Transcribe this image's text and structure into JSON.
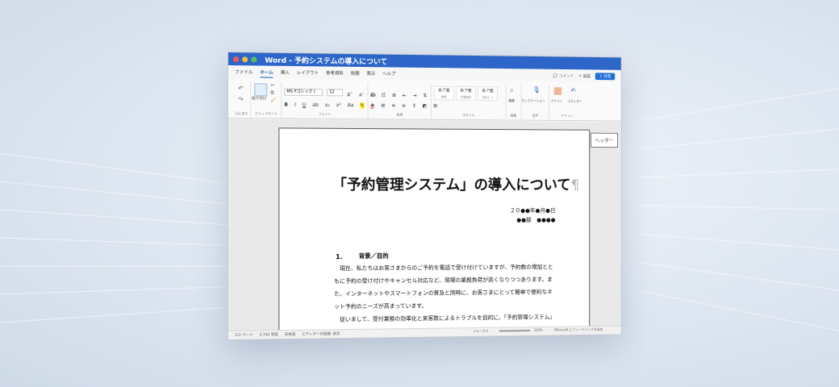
{
  "app": {
    "title": "Word - 予約システムの導入について"
  },
  "tabs": [
    "ファイル",
    "ホーム",
    "挿入",
    "レイアウト",
    "参考資料",
    "校閲",
    "表示",
    "ヘルプ"
  ],
  "title_right": {
    "comment": "コメント",
    "edit": "編集",
    "share": "共有"
  },
  "ribbon": {
    "undo_label": "元に戻す",
    "paste_label": "貼り付け",
    "clipboard_label": "クリップボード",
    "font_name": "MS Pゴシック (",
    "font_size": "12",
    "font_group_label": "フォント",
    "paragraph_group_label": "段落",
    "styles": [
      {
        "preview": "あア亜",
        "name": "標準"
      },
      {
        "preview": "あア亜",
        "name": "行間詰め"
      },
      {
        "preview": "あア亜",
        "name": "見出し 1"
      }
    ],
    "style_group_label": "スタイル",
    "edit_label": "編集",
    "dictate_label": "ディクテーション",
    "addin_label": "アドイン",
    "editor_label": "エディター",
    "voice_group_label": "音声",
    "addin_group_label": "アドイン"
  },
  "document": {
    "header_tag": "ヘッダー",
    "title": "「予約管理システム」の導入について",
    "pilcrow": "¶",
    "date": "２０●●年●月●日",
    "dept": "●●部　●●●●",
    "section_number": "1.",
    "section_title": "背景／目的",
    "body": [
      "　現在、私たちはお客さまからのご予約を電話で受け付けていますが、予約数の増加とと",
      "もに予約の受け付けやキャンセル対応など、現場の業務負荷が高くなりつつあります。ま",
      "た、インターネットやスマートフォンの普及と同時に、お客さまにとって簡単で便利なネ",
      "ット予約のニーズが高まっています。",
      "　従いまして、受付業務の効率化と来客数によるトラブルを目的に、「予約管理システム」"
    ]
  },
  "status": {
    "page": "1/3 ページ",
    "words": "3,742 単語",
    "language": "日本語",
    "editor": "エディターの候補: 表示",
    "focus": "フォーカス",
    "zoom": "100%",
    "feedback": "Microsoft にフィードバックを送信"
  }
}
